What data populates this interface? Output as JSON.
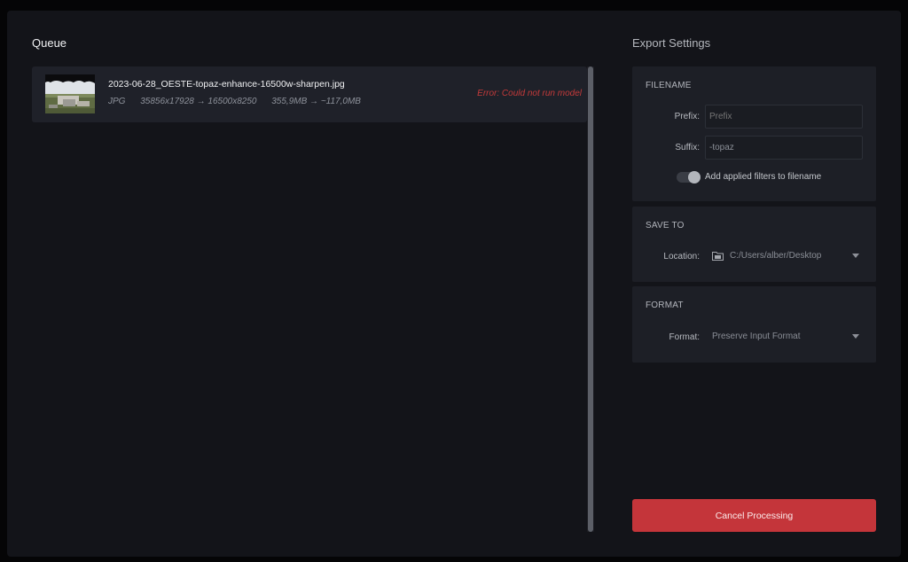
{
  "queue": {
    "title": "Queue",
    "items": [
      {
        "file_name": "2023-06-28_OESTE-topaz-enhance-16500w-sharpen.jpg",
        "format": "JPG",
        "dimensions": "35856x17928 → 16500x8250",
        "size": "355,9MB → ~117,0MB",
        "status": "Error: Could not run model",
        "thumbnail_icon": "landscape-thumbnail"
      }
    ]
  },
  "export_settings": {
    "title": "Export Settings",
    "filename": {
      "label": "FILENAME",
      "prefix_label": "Prefix:",
      "prefix_placeholder": "Prefix",
      "prefix_value": "",
      "suffix_label": "Suffix:",
      "suffix_value": "-topaz",
      "toggle_label": "Add applied filters to filename",
      "toggle_on": true
    },
    "save_to": {
      "label": "SAVE TO",
      "location_label": "Location:",
      "location_value": "C:/Users/alber/Desktop",
      "location_icon": "folder-icon"
    },
    "format": {
      "label": "FORMAT",
      "format_label": "Format:",
      "format_value": "Preserve Input Format"
    },
    "cancel_label": "Cancel Processing"
  },
  "colors": {
    "background": "#131419",
    "panel": "#1d1f26",
    "error": "#c43a3a",
    "accent_button": "#c4353a"
  }
}
